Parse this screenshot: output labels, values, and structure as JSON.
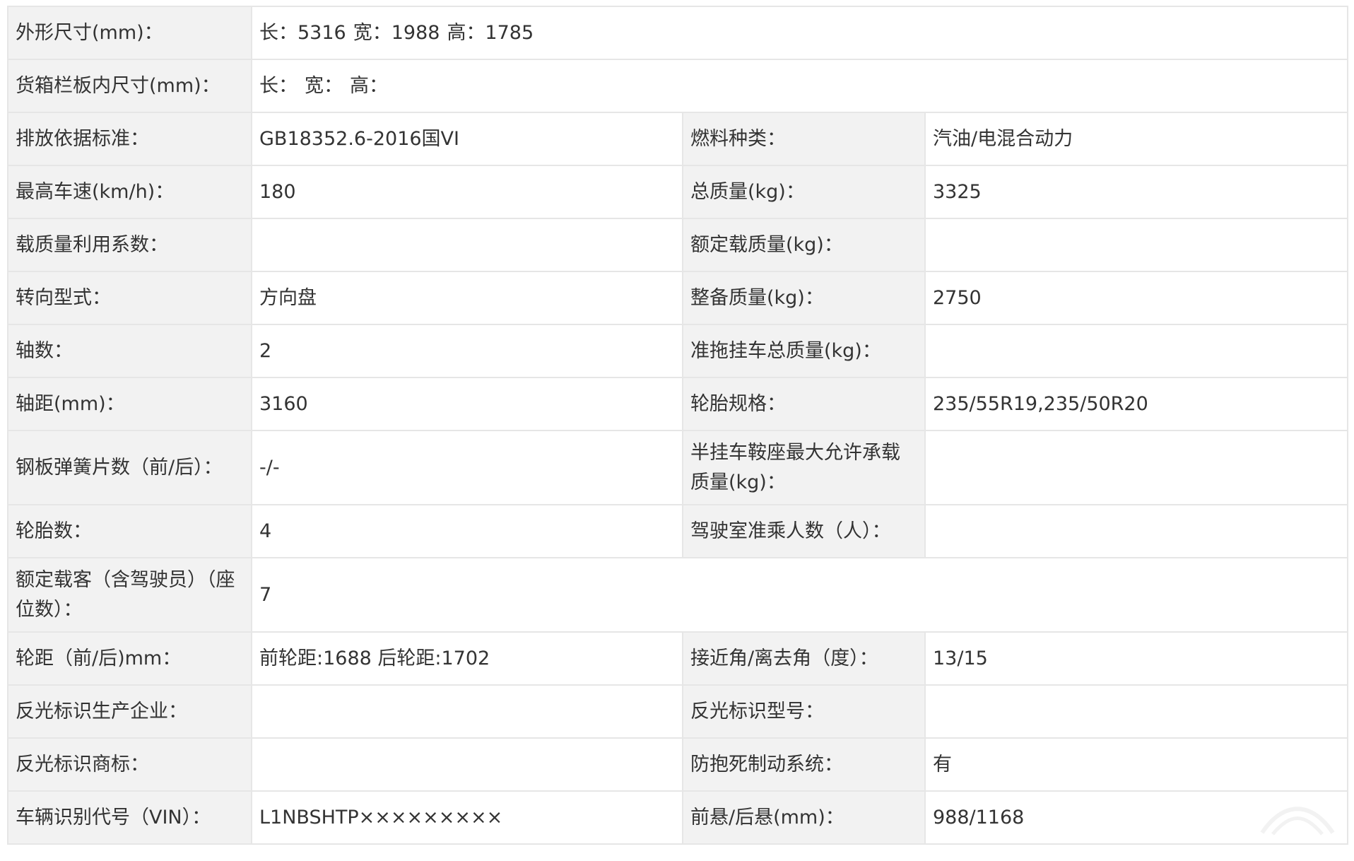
{
  "spec": {
    "dimensions": {
      "label": "外形尺寸(mm)：",
      "length": "长：5316",
      "width": "宽：1988",
      "height": "高：1785"
    },
    "cargo_box": {
      "label": "货箱栏板内尺寸(mm)：",
      "length": "长：",
      "width": "宽：",
      "height": "高："
    },
    "emission_standard": {
      "label": "排放依据标准：",
      "value": "GB18352.6-2016国VI"
    },
    "fuel_type": {
      "label": "燃料种类：",
      "value": "汽油/电混合动力"
    },
    "max_speed": {
      "label": "最高车速(km/h)：",
      "value": "180"
    },
    "total_mass": {
      "label": "总质量(kg)：",
      "value": "3325"
    },
    "load_utilization": {
      "label": "载质量利用系数：",
      "value": ""
    },
    "rated_load": {
      "label": "额定载质量(kg)：",
      "value": ""
    },
    "steering": {
      "label": "转向型式：",
      "value": "方向盘"
    },
    "curb_mass": {
      "label": "整备质量(kg)：",
      "value": "2750"
    },
    "axles": {
      "label": "轴数：",
      "value": "2"
    },
    "trailer_mass": {
      "label": "准拖挂车总质量(kg)：",
      "value": ""
    },
    "wheelbase": {
      "label": "轴距(mm)：",
      "value": "3160"
    },
    "tire_spec": {
      "label": "轮胎规格：",
      "value": "235/55R19,235/50R20"
    },
    "leaf_springs": {
      "label": "钢板弹簧片数（前/后）：",
      "value": "-/-"
    },
    "saddle_load": {
      "label": "半挂车鞍座最大允许承载质量(kg)：",
      "value": ""
    },
    "tire_count": {
      "label": "轮胎数：",
      "value": "4"
    },
    "cab_passengers": {
      "label": "驾驶室准乘人数（人）：",
      "value": ""
    },
    "rated_passengers": {
      "label": "额定载客（含驾驶员）（座位数）：",
      "value": "7"
    },
    "track": {
      "label": "轮距（前/后)mm：",
      "value": "前轮距:1688 后轮距:1702"
    },
    "approach_departure": {
      "label": "接近角/离去角（度）：",
      "value": "13/15"
    },
    "reflector_maker": {
      "label": "反光标识生产企业：",
      "value": ""
    },
    "reflector_model": {
      "label": "反光标识型号：",
      "value": ""
    },
    "reflector_brand": {
      "label": "反光标识商标：",
      "value": ""
    },
    "abs": {
      "label": "防抱死制动系统：",
      "value": "有"
    },
    "vin": {
      "label": "车辆识别代号（VIN）：",
      "value": "L1NBSHTP×××××××××"
    },
    "overhang": {
      "label": "前悬/后悬(mm)：",
      "value": "988/1168"
    }
  },
  "colors": {
    "label_bg": "#f2f2f2",
    "value_bg": "#ffffff",
    "border": "#e6e6e6",
    "text": "#333333"
  }
}
